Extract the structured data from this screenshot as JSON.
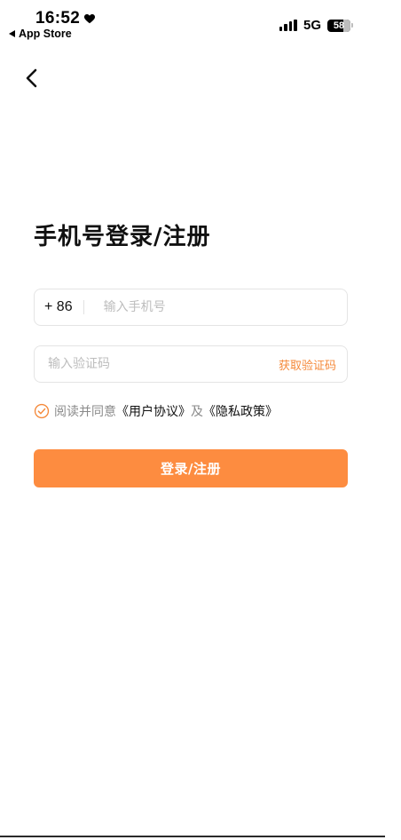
{
  "status_bar": {
    "time": "16:52",
    "back_app": "App Store",
    "network": "5G",
    "battery_level": "58"
  },
  "nav": {
    "back_icon": "chevron-left-icon"
  },
  "page": {
    "title": "手机号登录/注册"
  },
  "form": {
    "country_code": "+ 86",
    "phone_placeholder": "输入手机号",
    "code_placeholder": "输入验证码",
    "get_code_label": "获取验证码"
  },
  "agreement": {
    "prefix": "阅读并同意",
    "user_agreement": "《用户协议》",
    "conjunction": "及",
    "privacy_policy": "《隐私政策》",
    "checked": true
  },
  "submit": {
    "label": "登录/注册"
  },
  "colors": {
    "accent": "#fd8c40",
    "link_accent": "#f5893a"
  }
}
